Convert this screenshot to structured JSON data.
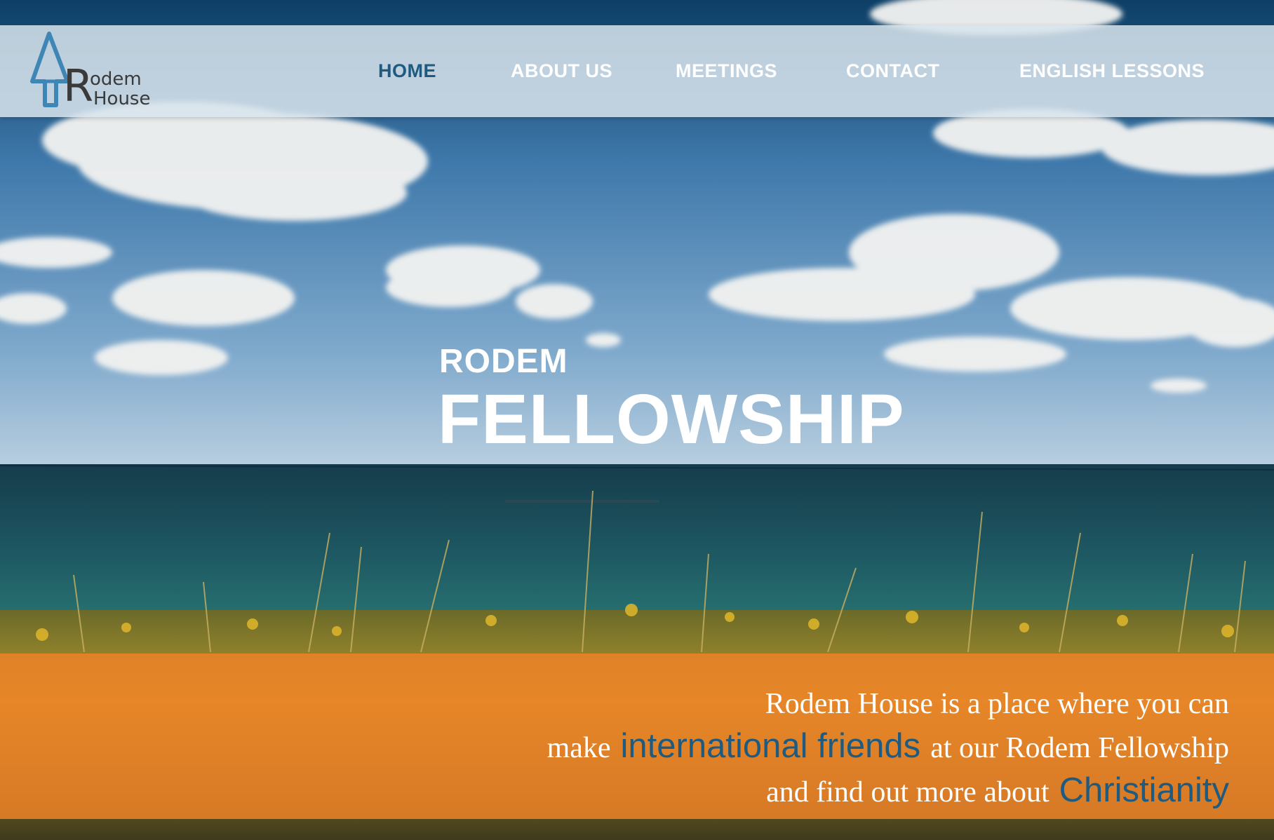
{
  "brand": {
    "logo_line1": "odem",
    "logo_initial": "R",
    "logo_line2": "House"
  },
  "nav": {
    "items": [
      {
        "label": "HOME",
        "active": true
      },
      {
        "label": "ABOUT US",
        "active": false
      },
      {
        "label": "MEETINGS",
        "active": false
      },
      {
        "label": "CONTACT",
        "active": false
      },
      {
        "label": "ENGLISH LESSONS",
        "active": false
      }
    ]
  },
  "hero": {
    "subtitle": "RODEM",
    "title": "FELLOWSHIP"
  },
  "tagline": {
    "line1": "Rodem House is a place where you can",
    "line2_before": "make",
    "line2_highlight": "international friends",
    "line2_after": "at our  Rodem Fellowship",
    "line3_before": "and find out more about",
    "line3_highlight": "Christianity"
  },
  "colors": {
    "accent_blue": "#1f5a80",
    "band_orange": "#ee8228",
    "nav_text": "#ffffff"
  }
}
